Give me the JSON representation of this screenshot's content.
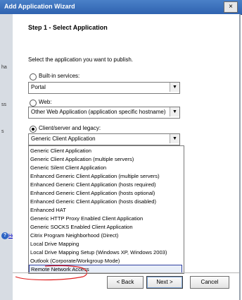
{
  "window": {
    "title": "Add Application Wizard",
    "close_glyph": "×"
  },
  "background_window": {
    "fragments": [
      "ha",
      "ss",
      "s"
    ],
    "help_link": "Help"
  },
  "step": {
    "title": "Step 1 - Select Application",
    "instruction": "Select the application you want to publish."
  },
  "options": {
    "builtin": {
      "label": "Built-in services:",
      "selected": false,
      "value": "Portal"
    },
    "web": {
      "label": "Web:",
      "selected": false,
      "value": "Other Web Application (application specific hostname)"
    },
    "client": {
      "label": "Client/server and legacy:",
      "selected": true,
      "value": "Generic Client Application"
    }
  },
  "dropdown": {
    "items": [
      "Generic Client Application",
      "Generic Client Application (multiple servers)",
      "Generic Silent Client Application",
      "Enhanced Generic Client Application (multiple servers)",
      "Enhanced Generic Client Application (hosts required)",
      "Enhanced Generic Client Application (hosts optional)",
      "Enhanced Generic Client Application (hosts disabled)",
      "Enhanced HAT",
      "Generic HTTP Proxy Enabled Client Application",
      "Generic SOCKS Enabled Client Application",
      "Citrix Program Neighborhood (Direct)",
      "Local Drive Mapping",
      "Local Drive Mapping Setup (Windows XP, Windows 2003)",
      "Outlook (Corporate/Workgroup Mode)",
      "Remote Network Access"
    ],
    "highlighted_index": 14
  },
  "buttons": {
    "back": "< Back",
    "next": "Next >",
    "cancel": "Cancel"
  },
  "colors": {
    "titlebar": "#2f63b0",
    "highlight_border": "#3040a0",
    "annotation": "#e02020"
  },
  "icons": {
    "help": "help-icon",
    "close": "close-icon",
    "dropdown": "chevron-down-icon"
  }
}
